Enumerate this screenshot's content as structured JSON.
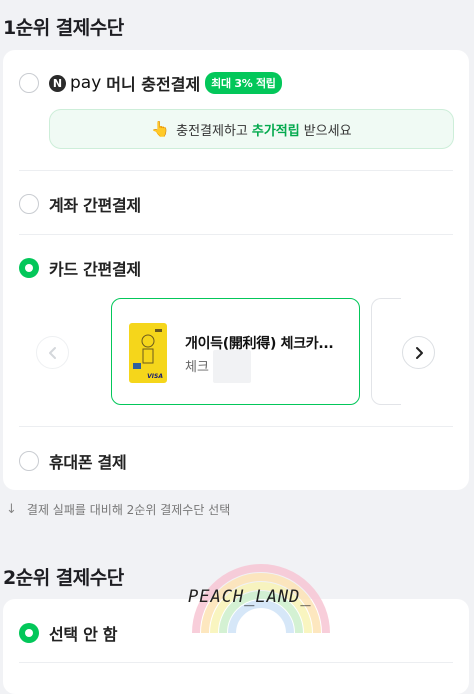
{
  "primary": {
    "title": "1순위 결제수단",
    "npay": {
      "logo_letter": "N",
      "pay_word": "pay",
      "label": "머니 충전결제",
      "badge": "최대 3% 적립",
      "promo_before": "충전결제하고",
      "promo_highlight": "추가적립",
      "promo_after": "받으세요",
      "promo_icon": "pointing-hand-icon"
    },
    "account": {
      "label": "계좌 간편결제"
    },
    "card": {
      "label": "카드 간편결제",
      "selected_card": {
        "name": "개이득(開利得) 체크카...",
        "type": "체크",
        "brand": "VISA"
      }
    },
    "phone": {
      "label": "휴대폰 결제"
    }
  },
  "note": "결제 실패를 대비해 2순위 결제수단 선택",
  "secondary": {
    "title": "2순위 결제수단",
    "option": {
      "label": "선택 안 함"
    }
  },
  "watermark": {
    "text": "PEACH_LAND_"
  },
  "colors": {
    "accent": "#03c75a",
    "background": "#f1f2f5"
  }
}
